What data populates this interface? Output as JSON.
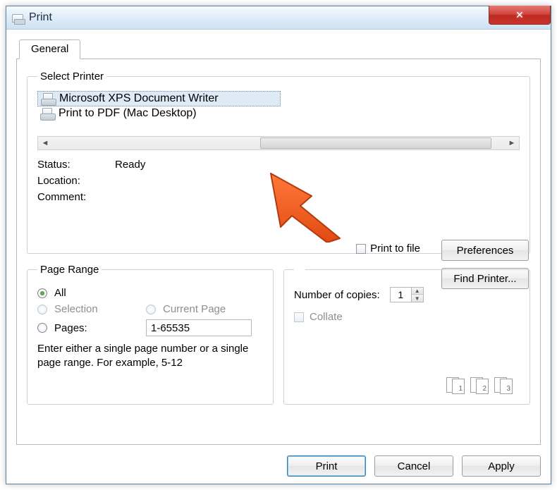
{
  "window": {
    "title": "Print"
  },
  "tabs": {
    "general": "General"
  },
  "select_printer": {
    "legend": "Select Printer",
    "items": [
      {
        "name": "Microsoft XPS Document Writer",
        "selected": true,
        "default": false
      },
      {
        "name": "Print to PDF (Mac Desktop)",
        "selected": false,
        "default": true
      }
    ]
  },
  "status": {
    "status_label": "Status:",
    "status_value": "Ready",
    "location_label": "Location:",
    "location_value": "",
    "comment_label": "Comment:",
    "comment_value": ""
  },
  "print_to_file_label": "Print to file",
  "buttons": {
    "preferences": "Preferences",
    "find_printer": "Find Printer...",
    "print": "Print",
    "cancel": "Cancel",
    "apply": "Apply"
  },
  "page_range": {
    "legend": "Page Range",
    "all": "All",
    "selection": "Selection",
    "current_page": "Current Page",
    "pages": "Pages:",
    "pages_value": "1-65535",
    "hint": "Enter either a single page number or a single page range.  For example, 5-12"
  },
  "copies": {
    "label": "Number of copies:",
    "value": "1",
    "collate": "Collate",
    "pairs": [
      "1",
      "2",
      "3"
    ]
  }
}
